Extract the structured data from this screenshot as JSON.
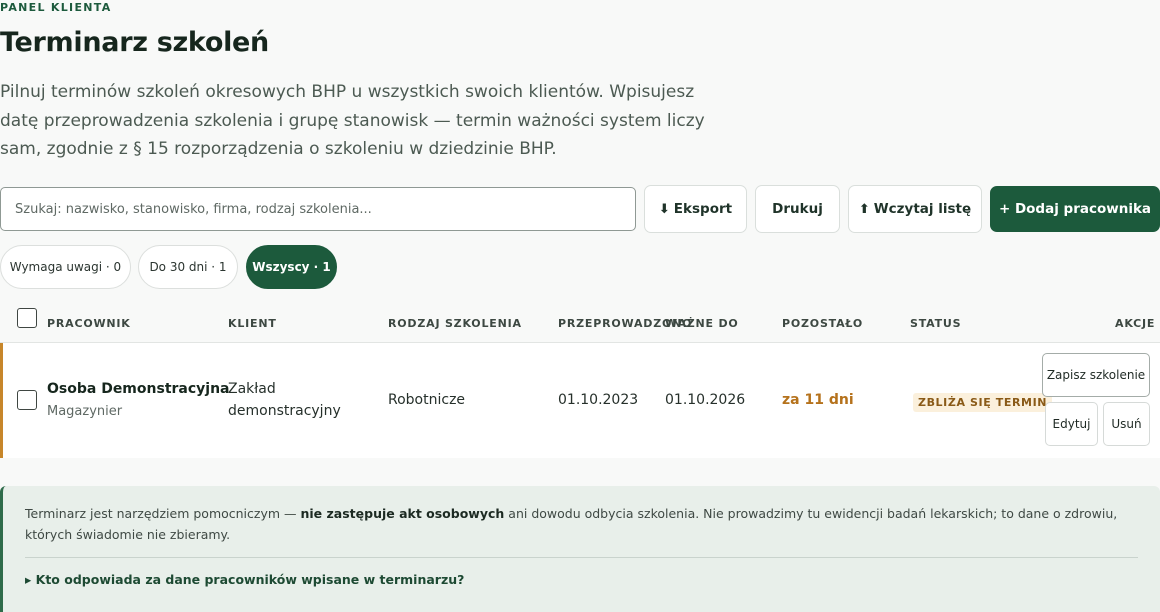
{
  "header": {
    "eyebrow": "PANEL KLIENTA",
    "title": "Terminarz szkoleń",
    "intro": "Pilnuj terminów szkoleń okresowych BHP u wszystkich swoich klientów. Wpisujesz datę przeprowadzenia szkolenia i grupę stanowisk — termin ważności system liczy sam, zgodnie z § 15 rozporządzenia o szkoleniu w dziedzinie BHP."
  },
  "toolbar": {
    "search_placeholder": "Szukaj: nazwisko, stanowisko, firma, rodzaj szkolenia...",
    "export_icon": "⬇",
    "export_label": "Eksport",
    "print_label": "Drukuj",
    "import_icon": "⬆",
    "import_label": "Wczytaj listę",
    "add_label": "+ Dodaj pracownika"
  },
  "filters": [
    {
      "label": "Wymaga uwagi · 0"
    },
    {
      "label": "Do 30 dni · 1"
    },
    {
      "label": "Wszyscy · 1"
    }
  ],
  "table": {
    "columns": {
      "employee": "PRACOWNIK",
      "client": "KLIENT",
      "type": "RODZAJ SZKOLENIA",
      "held": "PRZEPROWADZONO",
      "valid": "WAŻNE DO",
      "remaining": "POZOSTAŁO",
      "status": "STATUS",
      "actions": "AKCJE"
    },
    "rows": [
      {
        "name": "Osoba Demonstracyjna",
        "position": "Magazynier",
        "client_line1": "Zakład",
        "client_line2": "demonstracyjny",
        "type": "Robotnicze",
        "held": "01.10.2023",
        "valid": "01.10.2026",
        "remaining": "za 11 dni",
        "status": "ZBLIŻA SIĘ TERMIN",
        "action_record": "Zapisz szkolenie",
        "action_edit": "Edytuj",
        "action_delete": "Usuń"
      }
    ]
  },
  "note": {
    "text_before": "Terminarz jest narzędziem pomocniczym — ",
    "text_bold": "nie zastępuje akt osobowych",
    "text_after": " ani dowodu odbycia szkolenia. Nie prowadzimy tu ewidencji badań lekarskich; to dane o zdrowiu, których świadomie nie zbieramy.",
    "details_marker": "▸",
    "details_label": "Kto odpowiada za dane pracowników wpisane w terminarzu?"
  },
  "colors": {
    "accent": "#1c5a3c",
    "warning": "#b5721c",
    "warning_bg": "#fbf0dc"
  }
}
